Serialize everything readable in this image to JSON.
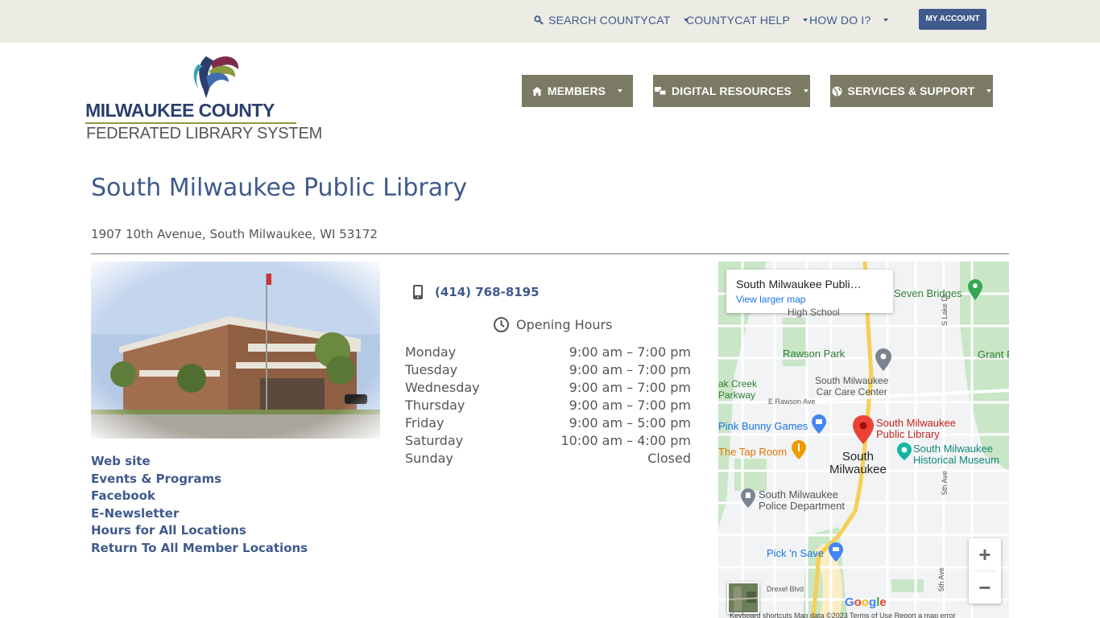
{
  "topbar": {
    "search": "SEARCH COUNTYCAT",
    "help": "COUNTYCAT HELP",
    "howdoi": "HOW DO I?",
    "account": "MY ACCOUNT"
  },
  "logo": {
    "top": "MILWAUKEE COUNTY",
    "bottom": "FEDERATED LIBRARY SYSTEM"
  },
  "nav": {
    "members": "MEMBERS",
    "digital": "DIGITAL RESOURCES",
    "services": "SERVICES & SUPPORT"
  },
  "library": {
    "name": "South Milwaukee Public Library",
    "address": "1907 10th Avenue, South Milwaukee, WI 53172",
    "phone": "(414) 768-8195"
  },
  "hours": {
    "heading": "Opening Hours",
    "rows": [
      {
        "day": "Monday",
        "time": "9:00 am – 7:00 pm"
      },
      {
        "day": "Tuesday",
        "time": "9:00 am – 7:00 pm"
      },
      {
        "day": "Wednesday",
        "time": "9:00 am – 7:00 pm"
      },
      {
        "day": "Thursday",
        "time": "9:00 am – 7:00 pm"
      },
      {
        "day": "Friday",
        "time": "9:00 am – 5:00 pm"
      },
      {
        "day": "Saturday",
        "time": "10:00 am – 4:00 pm"
      },
      {
        "day": "Sunday",
        "time": "Closed"
      }
    ]
  },
  "links": [
    "Web site",
    "Events & Programs",
    "Facebook",
    "E-Newsletter",
    "Hours for All Locations",
    "Return To All Member Locations"
  ],
  "map": {
    "card_title": "South Milwaukee Publi…",
    "card_link": "View larger map",
    "labels": {
      "seven_bridges": "Seven Bridges",
      "high_school": "High School",
      "rawson_park": "Rawson Park",
      "car_care": "South Milwaukee\nCar Care Center",
      "oak_creek": "ak Creek\nParkway",
      "e_rawson": "E Rawson Ave",
      "pink_bunny": "Pink Bunny Games",
      "library_pin": "South Milwaukee\nPublic Library",
      "tap_room": "The Tap Room",
      "city": "South\nMilwaukee",
      "museum": "South Milwaukee\nHistorical Museum",
      "police": "South Milwaukee\nPolice Department",
      "pick_n_save": "Pick 'n Save",
      "drexel": "Drexel Blvd",
      "grant_park": "Grant Pa",
      "lake_dr": "S Lake Dr",
      "fifth_ave": "5th Ave",
      "fifth_ave2": "5th Ave"
    },
    "zoom_in": "+",
    "zoom_out": "−",
    "google": "Google",
    "attribution": "Keyboard shortcuts    Map data ©2023    Terms of Use    Report a map error"
  }
}
